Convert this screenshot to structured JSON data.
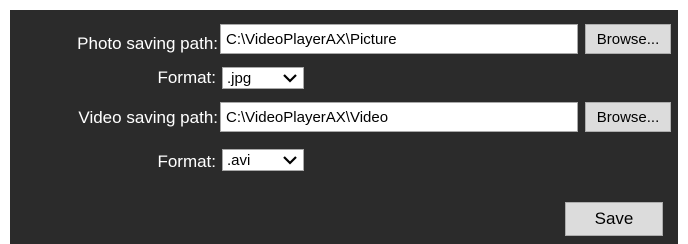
{
  "photo": {
    "label": "Photo saving path:",
    "path_value": "C:\\VideoPlayerAX\\Picture",
    "browse_label": "Browse...",
    "format_label": "Format:",
    "format_value": ".jpg"
  },
  "video": {
    "label": "Video saving path:",
    "path_value": "C:\\VideoPlayerAX\\Video",
    "browse_label": "Browse...",
    "format_label": "Format:",
    "format_value": ".avi"
  },
  "actions": {
    "save_label": "Save"
  },
  "colors": {
    "panel_bg": "#2b2b2b",
    "button_bg": "#dcdcdc",
    "field_bg": "#ffffff",
    "text_light": "#ffffff"
  },
  "icons": {
    "dropdown": "chevron-down-icon"
  }
}
